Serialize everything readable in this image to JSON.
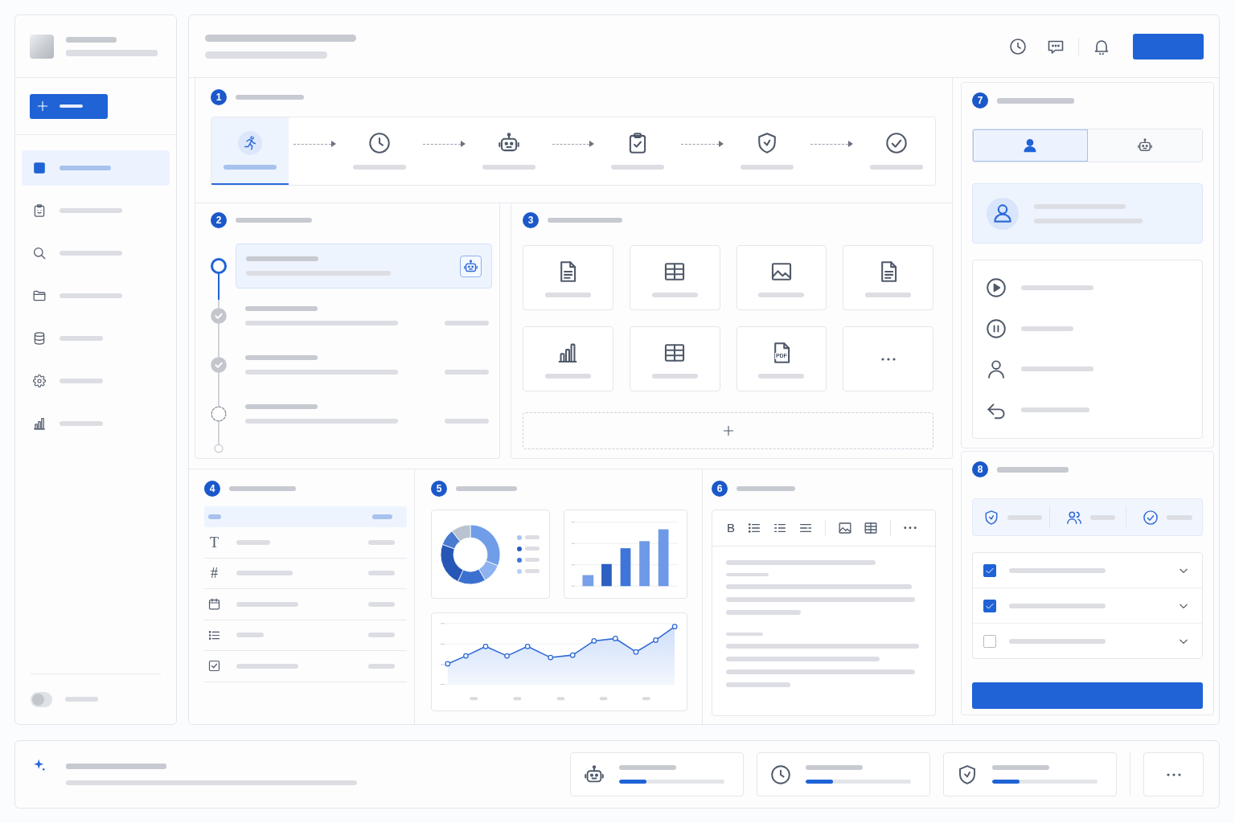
{
  "sidebar": {
    "items": [
      {
        "selected": true
      },
      {
        "selected": false
      },
      {
        "selected": false
      },
      {
        "selected": false
      },
      {
        "selected": false
      },
      {
        "selected": false
      },
      {
        "selected": false
      }
    ],
    "toggle": {
      "on": false
    }
  },
  "workflow": {
    "number": "1",
    "steps": [
      {
        "selected": true
      },
      {
        "selected": false
      },
      {
        "selected": false
      },
      {
        "selected": false
      },
      {
        "selected": false
      },
      {
        "selected": false
      }
    ]
  },
  "timeline": {
    "number": "2",
    "items": [
      {
        "kind": "active"
      },
      {
        "kind": "done"
      },
      {
        "kind": "done"
      },
      {
        "kind": "pending"
      }
    ]
  },
  "files": {
    "number": "3",
    "tiles": [
      {
        "kind": "document"
      },
      {
        "kind": "table"
      },
      {
        "kind": "image"
      },
      {
        "kind": "document"
      },
      {
        "kind": "chart"
      },
      {
        "kind": "table"
      },
      {
        "kind": "pdf",
        "label": "PDF"
      },
      {
        "kind": "more"
      }
    ]
  },
  "fields": {
    "number": "4",
    "rows": [
      {
        "kind": "text",
        "glyph": "T"
      },
      {
        "kind": "number",
        "glyph": "#"
      },
      {
        "kind": "date"
      },
      {
        "kind": "list"
      },
      {
        "kind": "checkbox"
      }
    ]
  },
  "charts": {
    "number": "5",
    "legend": [
      {
        "color": "#a9c4f0"
      },
      {
        "color": "#2a5cc0"
      },
      {
        "color": "#3d78df"
      },
      {
        "color": "#b8cff4"
      }
    ]
  },
  "editor": {
    "number": "6",
    "bold_button": "B"
  },
  "assignee": {
    "number": "7",
    "tabs": [
      {
        "selected": true
      },
      {
        "selected": false
      }
    ]
  },
  "review": {
    "number": "8",
    "checklist": [
      {
        "checked": true
      },
      {
        "checked": true
      },
      {
        "checked": false
      }
    ]
  },
  "footer": {
    "progress": [
      {
        "level": 0.26
      },
      {
        "level": 0.26
      },
      {
        "level": 0.26
      }
    ]
  }
}
